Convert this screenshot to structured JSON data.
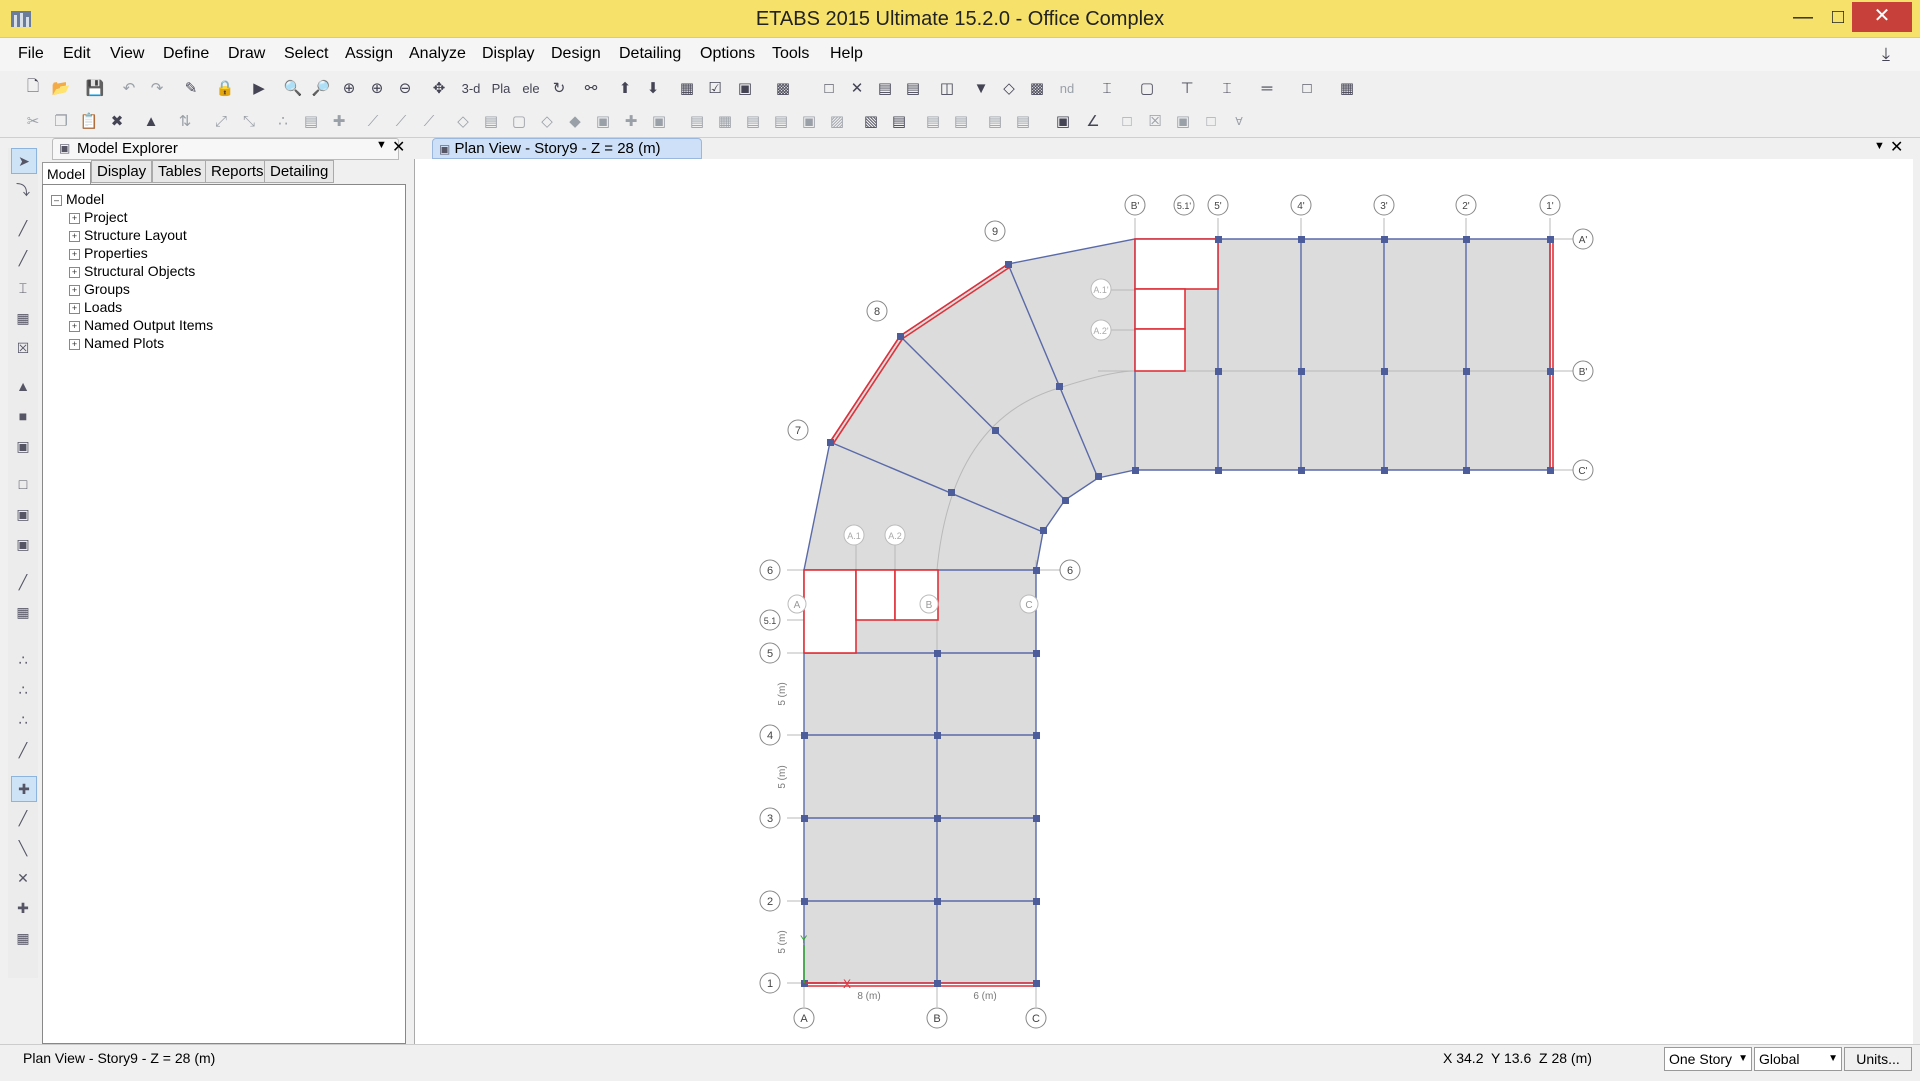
{
  "window": {
    "title": "ETABS 2015 Ultimate 15.2.0 - Office Complex"
  },
  "menu": [
    "File",
    "Edit",
    "View",
    "Define",
    "Draw",
    "Select",
    "Assign",
    "Analyze",
    "Display",
    "Design",
    "Detailing",
    "Options",
    "Tools",
    "Help"
  ],
  "toolbar": {
    "view_3d": "3-d",
    "plan": "Pla",
    "elev": "ele",
    "nd": "nd"
  },
  "explorer": {
    "title": "Model Explorer",
    "tabs": [
      "Model",
      "Display",
      "Tables",
      "Reports",
      "Detailing"
    ],
    "root": "Model",
    "items": [
      "Project",
      "Structure Layout",
      "Properties",
      "Structural Objects",
      "Groups",
      "Loads",
      "Named Output Items",
      "Named Plots"
    ]
  },
  "plan": {
    "tab_label": "Plan View - Story9 - Z = 28 (m)",
    "grid_labels": {
      "bottom": [
        "A",
        "B",
        "C"
      ],
      "left": [
        "6",
        "5.1",
        "5",
        "4",
        "3",
        "2",
        "1"
      ],
      "angled": [
        "7",
        "8",
        "9"
      ],
      "top": [
        "B'",
        "5.1'",
        "5'",
        "4'",
        "3'",
        "2'",
        "1'"
      ],
      "right": [
        "A'",
        "B'",
        "C'"
      ],
      "inner_top": [
        "A.1",
        "A.2"
      ],
      "inner_wing": [
        "A.1'",
        "A.2'"
      ],
      "inner_low": [
        "A",
        "B",
        "C"
      ],
      "right_of_6": "6"
    },
    "dims": {
      "dim1": "8 (m)",
      "dim2": "6 (m)",
      "dim_vert": "5 (m)"
    },
    "axes": {
      "x": "X",
      "y": "Y"
    }
  },
  "status": {
    "left": "Plan View - Story9 - Z = 28 (m)",
    "coords": "X 34.2  Y 13.6  Z 28 (m)",
    "story_select": "One Story",
    "coord_select": "Global",
    "units_button": "Units..."
  }
}
